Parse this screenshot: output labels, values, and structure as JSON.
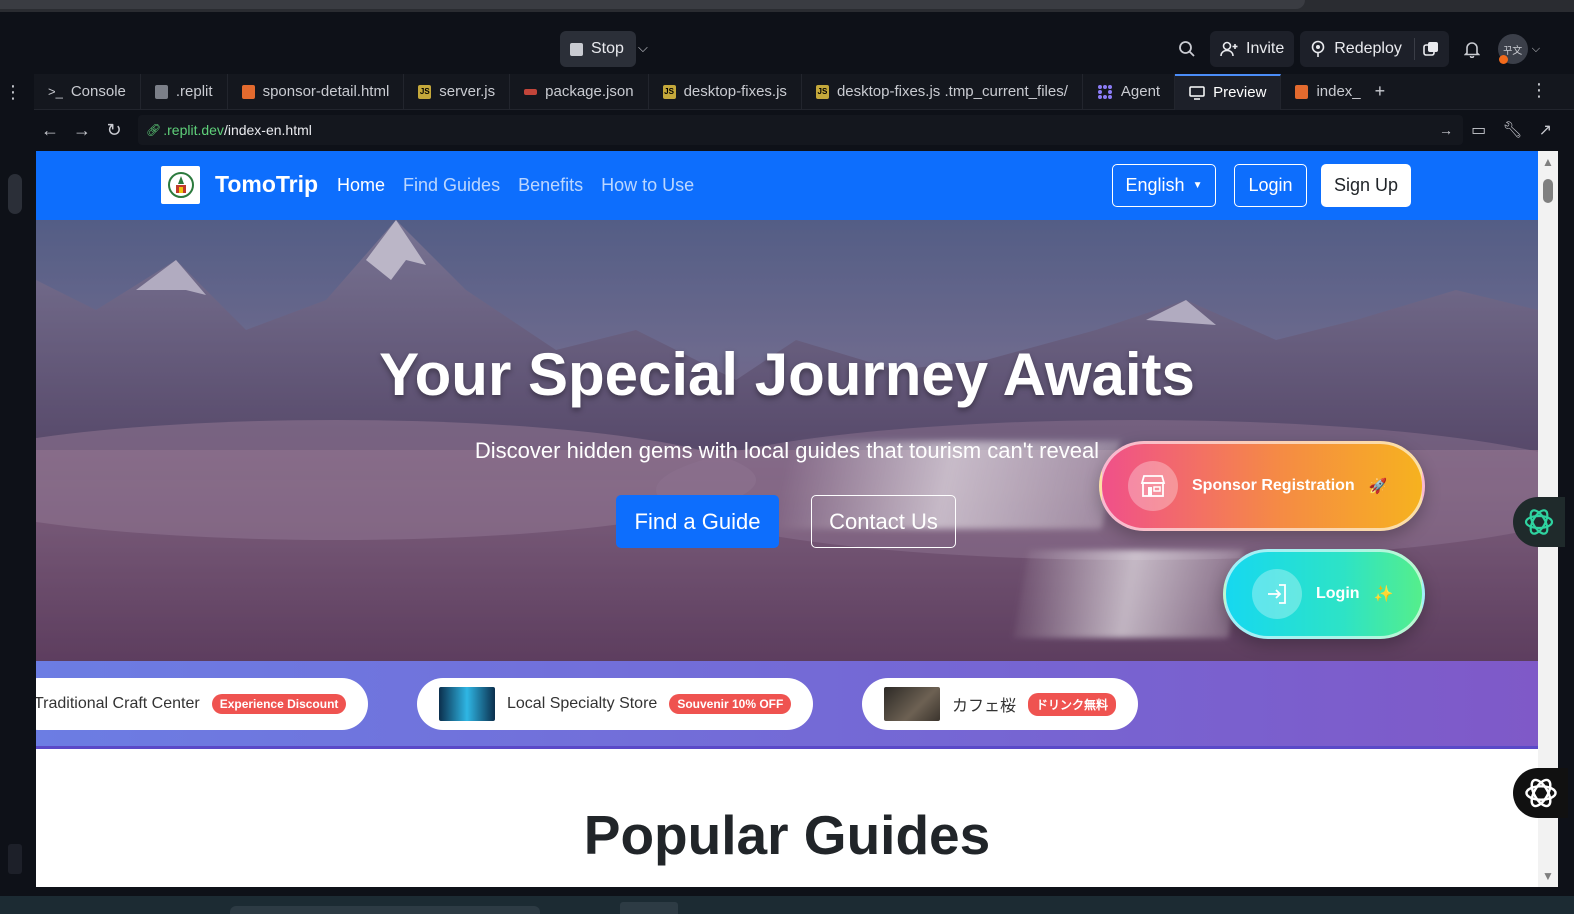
{
  "ide": {
    "stop_label": "Stop",
    "invite_label": "Invite",
    "redeploy_label": "Redeploy",
    "avatar_text": "꾸文",
    "tabs": [
      {
        "label": "Console",
        "icon": "terminal-icon"
      },
      {
        "label": ".replit",
        "icon": "replit-file-icon"
      },
      {
        "label": "sponsor-detail.html",
        "icon": "html-file-icon"
      },
      {
        "label": "server.js",
        "icon": "js-file-icon"
      },
      {
        "label": "package.json",
        "icon": "json-file-icon"
      },
      {
        "label": "desktop-fixes.js",
        "icon": "js-file-icon"
      },
      {
        "label": "desktop-fixes.js .tmp_current_files/",
        "icon": "js-file-icon"
      },
      {
        "label": "Agent",
        "icon": "agent-icon"
      },
      {
        "label": "Preview",
        "icon": "monitor-icon",
        "active": true
      },
      {
        "label": "index_",
        "icon": "html-file-icon"
      }
    ],
    "url_host": ".replit.dev",
    "url_path": "/index-en.html"
  },
  "site": {
    "brand": "TomoTrip",
    "nav": [
      {
        "label": "Home",
        "active": true
      },
      {
        "label": "Find Guides"
      },
      {
        "label": "Benefits"
      },
      {
        "label": "How to Use"
      }
    ],
    "lang_label": "English",
    "login_label": "Login",
    "signup_label": "Sign Up"
  },
  "hero": {
    "title": "Your Special Journey Awaits",
    "subtitle": "Discover hidden gems with local guides that tourism can't reveal",
    "find_guide_label": "Find a Guide",
    "contact_label": "Contact Us",
    "sponsor_fab_label": "Sponsor Registration",
    "login_fab_label": "Login"
  },
  "sponsors": [
    {
      "name": "Traditional Craft Center",
      "badge": "Experience Discount"
    },
    {
      "name": "Local Specialty Store",
      "badge": "Souvenir 10% OFF"
    },
    {
      "name": "カフェ桜",
      "badge": "ドリンク無料"
    }
  ],
  "popular_title": "Popular Guides",
  "colors": {
    "brand_blue": "#0d6efd",
    "badge_red": "#ef5350"
  }
}
